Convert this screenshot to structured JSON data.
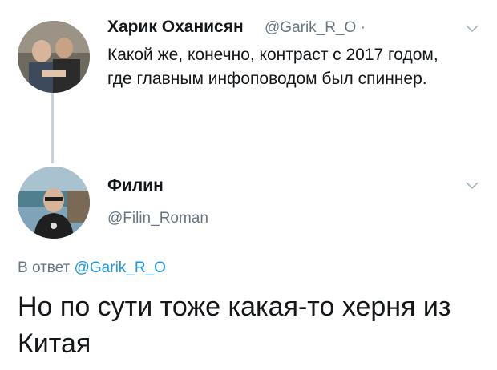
{
  "tweet1": {
    "name": "Харик Оханисян",
    "handle": "@Garik_R_O ·",
    "text": "Какой же, конечно, контраст с 2017 годом, где главным инфоповодом был спиннер."
  },
  "tweet2": {
    "name": "Филин",
    "handle": "@Filin_Roman",
    "reply_prefix": "В ответ",
    "reply_to": "@Garik_R_O",
    "text": "Но по сути тоже какая-то херня из Китая"
  },
  "colors": {
    "text": "#14171a",
    "muted": "#657786",
    "link": "#1b95e0",
    "thread_line": "#c9d2d9"
  },
  "icons": [
    "chevron-down-icon",
    "avatar"
  ]
}
